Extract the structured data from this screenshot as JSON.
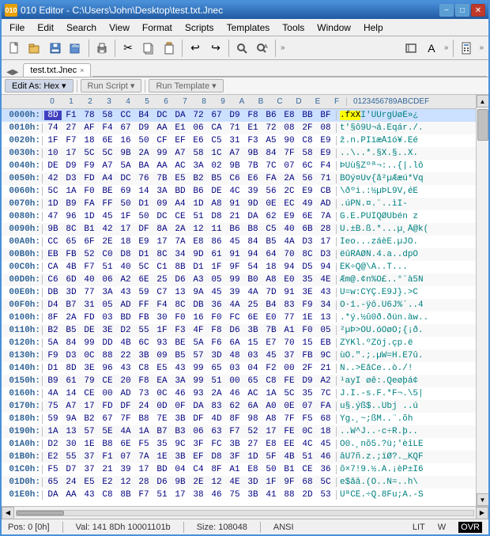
{
  "titleBar": {
    "icon": "010",
    "title": "010 Editor - C:\\Users\\John\\Desktop\\test.txt.Jnec",
    "minBtn": "−",
    "maxBtn": "□",
    "closeBtn": "✕"
  },
  "menuBar": {
    "items": [
      "File",
      "Edit",
      "Search",
      "View",
      "Format",
      "Scripts",
      "Templates",
      "Tools",
      "Window",
      "Help"
    ]
  },
  "toolbar": {
    "overflow": "»"
  },
  "tab": {
    "label": "test.txt.Jnec",
    "closeLabel": "×"
  },
  "subToolbar": {
    "editAs": "Edit As: Hex ▾",
    "runScript": "Run Script ▾",
    "runTemplate": "Run Template ▾"
  },
  "colHeaders": {
    "addr": "",
    "cols": [
      "0",
      "1",
      "2",
      "3",
      "4",
      "5",
      "6",
      "7",
      "8",
      "9",
      "A",
      "B",
      "C",
      "D",
      "E",
      "F"
    ],
    "ascii": "0123456789ABCDEF"
  },
  "hexRows": [
    {
      "addr": "0000h:",
      "bytes": [
        "8D",
        "F1",
        "78",
        "58",
        "CC",
        "B4",
        "DC",
        "DA",
        "72",
        "67",
        "D9",
        "F8",
        "B6",
        "E8",
        "BB",
        "BF"
      ],
      "ascii": ".fxXI'ÜÜrgÛøÉ»¿",
      "highlight": [
        0
      ]
    },
    {
      "addr": "0010h:",
      "bytes": [
        "74",
        "27",
        "AF",
        "F4",
        "67",
        "D9",
        "AA",
        "E1",
        "06",
        "CA",
        "71",
        "E1",
        "72",
        "08",
        "2F",
        "08"
      ],
      "ascii": "t'§ô9Ù¬á.Êqár./. "
    },
    {
      "addr": "0020h:",
      "bytes": [
        "1F",
        "F7",
        "18",
        "6E",
        "16",
        "50",
        "CF",
        "EF",
        "E6",
        "C5",
        "31",
        "F3",
        "A5",
        "90",
        "C8",
        "E9"
      ],
      "ascii": "ž.n.PÏïæÅ1ó¥.Èé"
    },
    {
      "addr": "0030h:",
      "bytes": [
        "10",
        "17",
        "5C",
        "5C",
        "9B",
        "2A",
        "99",
        "A7",
        "58",
        "1C",
        "A7",
        "9B",
        "84",
        "7F",
        "58",
        "E9"
      ],
      "ascii": "..\\..*.§X.§..X."
    },
    {
      "addr": "0040h:",
      "bytes": [
        "DE",
        "D9",
        "F9",
        "A7",
        "5A",
        "BA",
        "AA",
        "AC",
        "3A",
        "02",
        "9B",
        "7B",
        "7C",
        "07",
        "6C",
        "F4"
      ],
      "ascii": "ÞÙù§Zºª¬:..{|.lô"
    },
    {
      "addr": "0050h:",
      "bytes": [
        "42",
        "D3",
        "FD",
        "A4",
        "DC",
        "76",
        "7B",
        "E5",
        "B2",
        "B5",
        "C6",
        "E6",
        "FA",
        "2A",
        "56",
        "71"
      ],
      "ascii": "BÓý¤Üv{å²µÆæú*Vq"
    },
    {
      "addr": "0060h:",
      "bytes": [
        "5C",
        "1A",
        "F0",
        "BE",
        "69",
        "14",
        "3A",
        "BD",
        "B6",
        "DE",
        "4C",
        "39",
        "56",
        "2C",
        "E9",
        "CB"
      ],
      "ascii": "\\ðºi.:½µÞL9V,éË"
    },
    {
      "addr": "0070h:",
      "bytes": [
        "1D",
        "B9",
        "FA",
        "FF",
        "50",
        "D1",
        "09",
        "A4",
        "1D",
        "A8",
        "91",
        "9D",
        "0E",
        "EC",
        "49",
        "AD"
      ],
      "ascii": ".úPN.¤.¨..ìI-"
    },
    {
      "addr": "0080h:",
      "bytes": [
        "47",
        "96",
        "1D",
        "45",
        "1F",
        "50",
        "DC",
        "CE",
        "51",
        "D8",
        "21",
        "DA",
        "62",
        "E9",
        "6E",
        "7A"
      ],
      "ascii": "G.E.PÜÎQØÚbén z"
    },
    {
      "addr": "0090h:",
      "bytes": [
        "9B",
        "8C",
        "B1",
        "42",
        "17",
        "DF",
        "8A",
        "2A",
        "12",
        "11",
        "B6",
        "B8",
        "C5",
        "40",
        "6B",
        "28"
      ],
      "ascii": "Ü.±B.ß.*...µ¸Å@k("
    },
    {
      "addr": "00A0h:",
      "bytes": [
        "CC",
        "65",
        "6F",
        "2E",
        "18",
        "E9",
        "17",
        "7A",
        "E8",
        "86",
        "45",
        "84",
        "B5",
        "4A",
        "D3",
        "17"
      ],
      "ascii": "Ìeo...záèE.µJÓ."
    },
    {
      "addr": "00B0h:",
      "bytes": [
        "EB",
        "FB",
        "52",
        "C0",
        "D8",
        "D1",
        "8C",
        "34",
        "9D",
        "61",
        "91",
        "94",
        "64",
        "70",
        "8C",
        "D3"
      ],
      "ascii": "ëûRÀØÑ.4.a..dpÓ"
    },
    {
      "addr": "00C0h:",
      "bytes": [
        "CA",
        "4B",
        "F7",
        "51",
        "40",
        "5C",
        "C1",
        "8B",
        "D1",
        "1F",
        "9F",
        "54",
        "18",
        "94",
        "D5",
        "94"
      ],
      "ascii": "ÊK÷Q@\\Á..T..."
    },
    {
      "addr": "00D0h:",
      "bytes": [
        "C6",
        "6D",
        "40",
        "06",
        "A2",
        "6E",
        "25",
        "D6",
        "A3",
        "05",
        "99",
        "B0",
        "A8",
        "E0",
        "35",
        "4E"
      ],
      "ascii": "Æm@.¢n%Ö£..°¨à5N"
    },
    {
      "addr": "00E0h:",
      "bytes": [
        "DB",
        "3D",
        "77",
        "3A",
        "43",
        "59",
        "C7",
        "13",
        "9A",
        "45",
        "39",
        "4A",
        "7D",
        "91",
        "3E",
        "43"
      ],
      "ascii": "Û=w:CYÇ.E9J}.>C"
    },
    {
      "addr": "00F0h:",
      "bytes": [
        "D4",
        "B7",
        "31",
        "05",
        "AD",
        "FF",
        "F4",
        "8C",
        "DB",
        "36",
        "4A",
        "25",
        "B4",
        "83",
        "F9",
        "34"
      ],
      "ascii": "Ô·1.-ÿô.Û6J%´..4"
    },
    {
      "addr": "0100h:",
      "bytes": [
        "8F",
        "2A",
        "FD",
        "03",
        "BD",
        "FB",
        "30",
        "F0",
        "16",
        "F0",
        "FC",
        "6E",
        "E0",
        "77",
        "1E",
        "13"
      ],
      "ascii": ".*ý.½û0ð.ðün.àw.."
    },
    {
      "addr": "0110h:",
      "bytes": [
        "B2",
        "B5",
        "DE",
        "3E",
        "D2",
        "55",
        "1F",
        "F3",
        "4F",
        "F8",
        "D6",
        "3B",
        "7B",
        "A1",
        "F0",
        "05"
      ],
      "ascii": "²µÞ>ÒU.óOøÖ;{¡ð."
    },
    {
      "addr": "0120h:",
      "bytes": [
        "5A",
        "84",
        "99",
        "DD",
        "4B",
        "6C",
        "93",
        "BE",
        "5A",
        "F6",
        "6A",
        "15",
        "E7",
        "70",
        "15",
        "EB"
      ],
      "ascii": "ZÝKl.ºZöj.çp.ë"
    },
    {
      "addr": "0130h:",
      "bytes": [
        "F9",
        "D3",
        "0C",
        "88",
        "22",
        "3B",
        "09",
        "B5",
        "57",
        "3D",
        "48",
        "03",
        "45",
        "37",
        "FB",
        "9C"
      ],
      "ascii": "ùÓ.\".;.µW=H.E7û."
    },
    {
      "addr": "0140h:",
      "bytes": [
        "D1",
        "8D",
        "3E",
        "96",
        "43",
        "C8",
        "E5",
        "43",
        "99",
        "65",
        "03",
        "04",
        "F2",
        "00",
        "2F",
        "21"
      ],
      "ascii": "Ñ..>ÈåCe..ò./!"
    },
    {
      "addr": "0150h:",
      "bytes": [
        "B9",
        "61",
        "79",
        "CE",
        "20",
        "F8",
        "EA",
        "3A",
        "99",
        "51",
        "00",
        "65",
        "C8",
        "FE",
        "D9",
        "A2"
      ],
      "ascii": "¹ayÎ øê:.Qeøþá¢"
    },
    {
      "addr": "0160h:",
      "bytes": [
        "4A",
        "14",
        "CE",
        "00",
        "AD",
        "73",
        "0C",
        "46",
        "93",
        "2A",
        "46",
        "AC",
        "1A",
        "5C",
        "35",
        "7C"
      ],
      "ascii": "J.Î.-s.F.*F¬.\\5|"
    },
    {
      "addr": "0170h:",
      "bytes": [
        "75",
        "A7",
        "17",
        "FD",
        "DF",
        "24",
        "0D",
        "0F",
        "DA",
        "83",
        "62",
        "6A",
        "A0",
        "0E",
        "07",
        "FA"
      ],
      "ascii": "u§.ýß$..Úbj ..ú"
    },
    {
      "addr": "0180h:",
      "bytes": [
        "59",
        "9A",
        "B2",
        "67",
        "7F",
        "B8",
        "7E",
        "3B",
        "DF",
        "4D",
        "8F",
        "98",
        "A8",
        "7F",
        "F5",
        "68"
      ],
      "ascii": "Yg.¸~;ßM..¨.õh"
    },
    {
      "addr": "0190h:",
      "bytes": [
        "1A",
        "13",
        "57",
        "5E",
        "4A",
        "1A",
        "B7",
        "B3",
        "06",
        "63",
        "F7",
        "52",
        "17",
        "FE",
        "0C",
        "18"
      ],
      "ascii": "..W^J..·c÷R.þ.."
    },
    {
      "addr": "01A0h:",
      "bytes": [
        "D2",
        "30",
        "1E",
        "B8",
        "6E",
        "F5",
        "35",
        "9C",
        "3F",
        "FC",
        "3B",
        "27",
        "E8",
        "EE",
        "4C",
        "45"
      ],
      "ascii": "Ò0.¸nõ5.?ü;'èîLE"
    },
    {
      "addr": "01B0h:",
      "bytes": [
        "E2",
        "55",
        "37",
        "F1",
        "07",
        "7A",
        "1E",
        "3B",
        "EF",
        "D8",
        "3F",
        "1D",
        "5F",
        "4B",
        "51",
        "46"
      ],
      "ascii": "âU7ñ.z.;ïØ?._KQF"
    },
    {
      "addr": "01C0h:",
      "bytes": [
        "F5",
        "D7",
        "37",
        "21",
        "39",
        "17",
        "BD",
        "04",
        "C4",
        "8F",
        "A1",
        "E8",
        "50",
        "B1",
        "CE",
        "36"
      ],
      "ascii": "õ×7!9.½.Ä.¡èP±Î6"
    },
    {
      "addr": "01D0h:",
      "bytes": [
        "65",
        "24",
        "E5",
        "E2",
        "12",
        "28",
        "D6",
        "9B",
        "2E",
        "12",
        "4E",
        "3D",
        "1F",
        "9F",
        "68",
        "5C"
      ],
      "ascii": "e$åâ.(Ö..N=..h\\"
    },
    {
      "addr": "01E0h:",
      "bytes": [
        "DA",
        "AA",
        "43",
        "C8",
        "8B",
        "F7",
        "51",
        "17",
        "38",
        "46",
        "75",
        "3B",
        "41",
        "88",
        "2D",
        "53"
      ],
      "ascii": "ÚªCÈ.÷Q.8Fu;A.-S"
    }
  ],
  "statusBar": {
    "pos": "Pos: 0 [0h]",
    "val": "Val: 141 8Dh 10001101b",
    "size": "Size: 108048",
    "encoding": "ANSI",
    "lit": "LIT",
    "w": "W",
    "ovr": "OVR"
  },
  "icons": {
    "new": "📄",
    "open": "📂",
    "save": "💾",
    "print": "🖨",
    "cut": "✂",
    "copy": "📋",
    "paste": "📌",
    "undo": "↩",
    "redo": "↪",
    "find": "🔍",
    "run": "▶",
    "overflow": "»"
  }
}
